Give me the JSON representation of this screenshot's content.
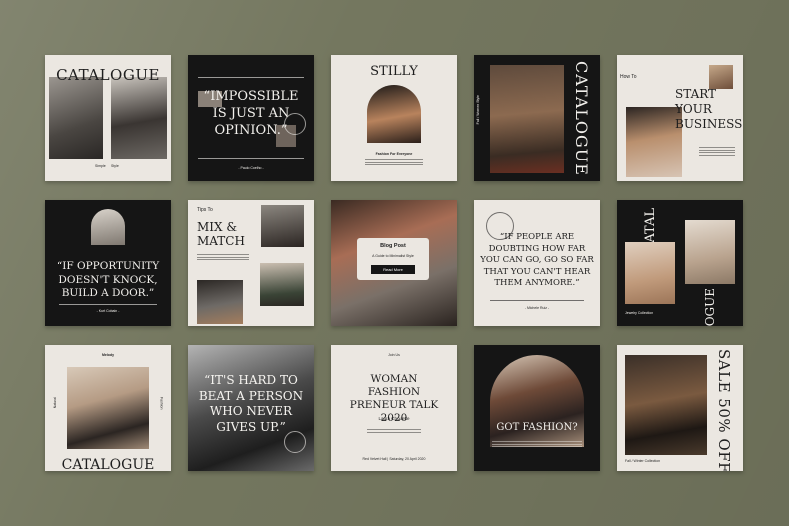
{
  "row1": {
    "card1": {
      "title": "CATALOGUE",
      "tag_simple": "Simple",
      "tag_style": "Style"
    },
    "card2": {
      "quote": "“IMPOSSIBLE IS JUST AN OPINION.”",
      "author": "- Paulo Coelho -"
    },
    "card3": {
      "title": "STILLY",
      "subtitle": "Fashion For Everyone"
    },
    "card4": {
      "vertical_title": "CATALOGUE",
      "side_note": "Fall / Women Style"
    },
    "card5": {
      "kicker": "How To",
      "title": "START YOUR BUSINESS"
    }
  },
  "row2": {
    "card6": {
      "quote": "“IF OPPORTUNITY DOESN'T KNOCK, BUILD A DOOR.”",
      "author": "- Kurt Cobain -"
    },
    "card7": {
      "kicker": "Tips To",
      "title": "MIX & MATCH"
    },
    "card8": {
      "badge_title": "Blog Post",
      "badge_subtitle": "A Guide to Minimalist Style",
      "button": "Read More"
    },
    "card9": {
      "quote": "“IF PEOPLE ARE DOUBTING HOW FAR YOU CAN GO, GO SO FAR THAT YOU CAN'T HEAR THEM ANYMORE.”",
      "author": "- Michele Ruiz -"
    },
    "card10": {
      "title_top": "CATAL",
      "title_bottom": "OGUE",
      "caption": "Jewelry Collection"
    }
  },
  "row3": {
    "card11": {
      "kicker": "Melody",
      "side_left": "Natural",
      "side_right": "Fashion",
      "title": "CATALOGUE"
    },
    "card12": {
      "quote": "“IT'S HARD TO BEAT A PERSON WHO NEVER GIVES UP.”"
    },
    "card13": {
      "kicker": "Join Us",
      "title": "WOMAN FASHION PRENEUR TALK 2020",
      "name": "Laura Chouette",
      "footer": "Red Velvet Hall   |   Saturday, 20 April 2020"
    },
    "card14": {
      "title": "GOT FASHION?"
    },
    "card15": {
      "vertical_title": "SALE 50% OFF",
      "caption": "Fall / Winter Collection"
    }
  }
}
